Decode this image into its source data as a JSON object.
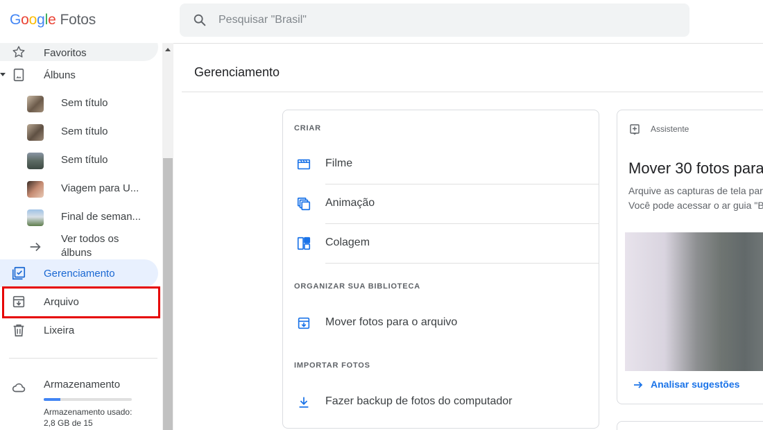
{
  "header": {
    "logo_g1": "G",
    "logo_g2": "o",
    "logo_g3": "o",
    "logo_g4": "g",
    "logo_g5": "l",
    "logo_g6": "e",
    "product": "Fotos",
    "search_placeholder": "Pesquisar \"Brasil\""
  },
  "sidebar": {
    "favorites": "Favoritos",
    "albums": "Álbuns",
    "album_items": [
      {
        "label": "Sem título"
      },
      {
        "label": "Sem título"
      },
      {
        "label": "Sem título"
      },
      {
        "label": "Viagem para U..."
      },
      {
        "label": "Final de seman..."
      }
    ],
    "all_albums": "Ver todos os álbuns",
    "management": "Gerenciamento",
    "archive": "Arquivo",
    "trash": "Lixeira",
    "storage_title": "Armazenamento",
    "storage_used": "Armazenamento usado: 2,8 GB de 15",
    "storage_fraction": 0.19
  },
  "main": {
    "title": "Gerenciamento",
    "create_head": "CRIAR",
    "create_items": [
      {
        "label": "Filme"
      },
      {
        "label": "Animação"
      },
      {
        "label": "Colagem"
      }
    ],
    "organize_head": "ORGANIZAR SUA BIBLIOTECA",
    "organize_item": "Mover fotos para o arquivo",
    "import_head": "IMPORTAR FOTOS",
    "import_item": "Fazer backup de fotos do computador"
  },
  "assistant": {
    "label": "Assistente",
    "title": "Mover 30 fotos para",
    "description": "Arquive as capturas de tela para Fotos. Você pode acessar o ar guia \"Biblioteca\".",
    "action": "Analisar sugestões"
  },
  "colors": {
    "accent": "#1a73e8",
    "active_bg": "#e8f0fe",
    "highlight": "#e60000"
  }
}
